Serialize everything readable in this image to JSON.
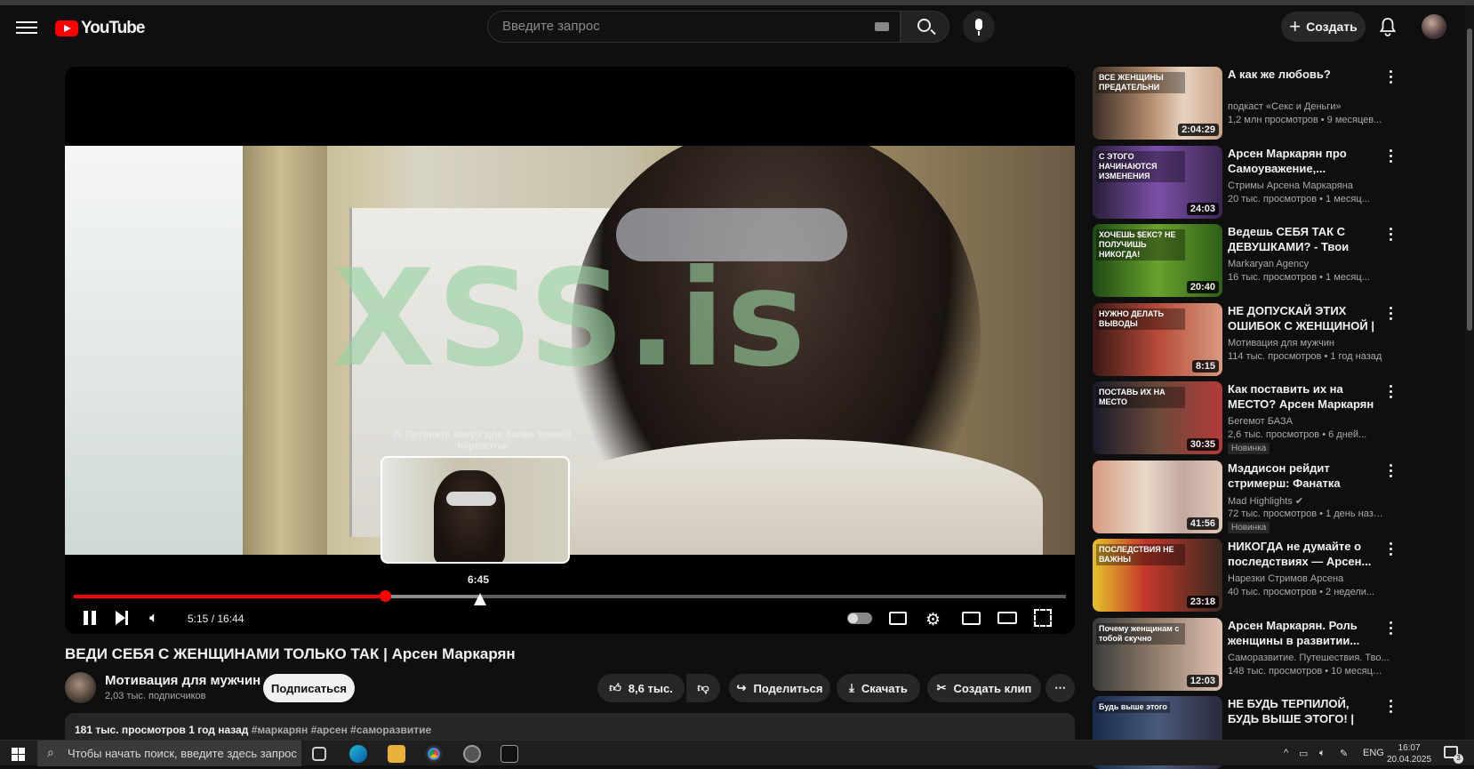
{
  "header": {
    "logo_text": "YouTube",
    "search_placeholder": "Введите запрос",
    "create_label": "Создать",
    "icons": [
      "menu-icon",
      "keyboard-icon",
      "search-icon",
      "mic-icon",
      "plus-icon",
      "bell-icon"
    ]
  },
  "player": {
    "watermark": "XSS.is",
    "seek_hint": "⇱ Потяните вверх для более точной перемотки",
    "preview_time": "6:45",
    "current_time": "5:15",
    "duration": "16:44",
    "time_display": "5:15 / 16:44",
    "played_fraction": 0.314,
    "buffered_fraction": 0.408,
    "accent_color": "#ff0000"
  },
  "video": {
    "title": "ВЕДИ СЕБЯ С ЖЕНЩИНАМИ ТОЛЬКО ТАК | Арсен Маркарян",
    "channel": "Мотивация для мужчин",
    "subscribers": "2,03 тыс. подписчиков",
    "subscribe_label": "Подписаться",
    "likes": "8,6 тыс.",
    "share_label": "Поделиться",
    "download_label": "Скачать",
    "clip_label": "Создать клип",
    "views_date": "181 тыс. просмотров  1 год назад",
    "tags": "#маркарян #арсен #саморазвитие"
  },
  "recommendations": [
    {
      "title": "А как же любовь?",
      "channel": "подкаст «Секс и Деньги»",
      "meta": "1,2 млн просмотров • 9 месяцев...",
      "duration": "2:04:29",
      "thumb_text": "ВСЕ ЖЕНЩИНЫ ПРЕДАТЕЛЬНИ",
      "badge": ""
    },
    {
      "title": "Арсен Маркарян про Самоуважение,...",
      "channel": "Стримы Арсена Маркаряна",
      "meta": "20 тыс. просмотров • 1 месяц...",
      "duration": "24:03",
      "thumb_text": "С ЭТОГО НАЧИНАЮТСЯ ИЗМЕНЕНИЯ",
      "badge": ""
    },
    {
      "title": "Ведешь СЕБЯ ТАК С ДЕВУШКАМИ? - Твои ШАНС...",
      "channel": "Markaryan Agency",
      "meta": "16 тыс. просмотров • 1 месяц...",
      "duration": "20:40",
      "thumb_text": "ХОЧЕШЬ $ЕКС? НЕ ПОЛУЧИШЬ НИКОГДА!",
      "badge": ""
    },
    {
      "title": "НЕ ДОПУСКАЙ ЭТИХ ОШИБОК С ЖЕНЩИНОЙ | Арсен...",
      "channel": "Мотивация для мужчин",
      "meta": "114 тыс. просмотров • 1 год назад",
      "duration": "8:15",
      "thumb_text": "НУЖНО ДЕЛАТЬ ВЫВОДЫ",
      "badge": ""
    },
    {
      "title": "Как поставить их на МЕСТО? Арсен Маркарян",
      "channel": "Бегемот БАЗА",
      "meta": "2,6 тыс. просмотров • 6 дней...",
      "duration": "30:35",
      "thumb_text": "ПОСТАВЬ ИХ НА МЕСТО",
      "badge": "Новинка"
    },
    {
      "title": "Мэддисон рейдит стримерш: Фанатка Динамо и Боевая...",
      "channel": "Mad Highlights",
      "meta": "72 тыс. просмотров • 1 день назад",
      "duration": "41:56",
      "thumb_text": "",
      "badge": "Новинка",
      "verified": true
    },
    {
      "title": "НИКОГДА не думайте о последствиях — Арсен...",
      "channel": "Нарезки Стримов Арсена",
      "meta": "40 тыс. просмотров • 2 недели...",
      "duration": "23:18",
      "thumb_text": "ПОСЛЕДСТВИЯ НЕ ВАЖНЫ",
      "badge": ""
    },
    {
      "title": "Арсен Маркарян. Роль женщины в развитии...",
      "channel": "Саморазвитие. Путешествия. Тво...",
      "meta": "148 тыс. просмотров • 10 месяце...",
      "duration": "12:03",
      "thumb_text": "Почему женщинам с тобой скучно",
      "badge": ""
    },
    {
      "title": "НЕ БУДЬ ТЕРПИЛОЙ, БУДЬ ВЫШЕ ЭТОГО! | Арсен...",
      "channel": "",
      "meta": "",
      "duration": "",
      "thumb_text": "Будь выше этого",
      "badge": ""
    }
  ],
  "taskbar": {
    "search_placeholder": "Чтобы начать поиск, введите здесь запрос",
    "lang": "ENG",
    "time": "16:07",
    "date": "20.04.2025",
    "notif_count": "3"
  }
}
